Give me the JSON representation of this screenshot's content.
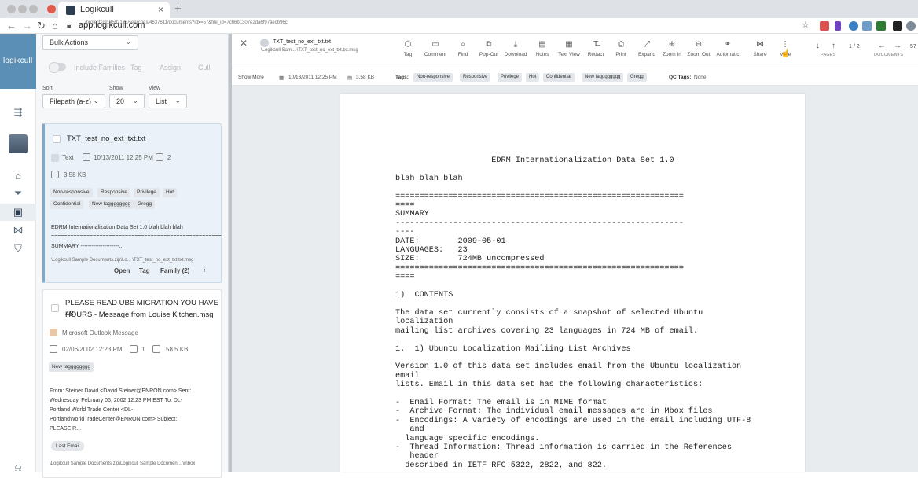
{
  "browser": {
    "tab_title": "Logikcull",
    "tab_close": "×",
    "new_tab": "+",
    "url_host": "app.logikcull.com",
    "url_path": "/projects/919592123/searches/4637611/documents?idx=57&file_id=7c66b1307e2da6f97aecb96c"
  },
  "app": {
    "logo": "logikcull"
  },
  "results": {
    "bulk_actions": "Bulk Actions",
    "include_families": "Include Families",
    "filter_tag": "Tag",
    "filter_assign": "Assign",
    "filter_cull": "Cull",
    "sort_label": "Sort",
    "sort_value": "Filepath (a-z)",
    "show_label": "Show",
    "show_value": "20",
    "view_label": "View",
    "view_value": "List",
    "cards": [
      {
        "title": "TXT_test_no_ext_txt.txt",
        "type": "Text",
        "date": "10/13/2011 12:25 PM",
        "pages": "2",
        "size": "3.58 KB",
        "tags": [
          "Non-responsive",
          "Responsive",
          "Privilege",
          "Hot",
          "Confidential",
          "New tagggggggg",
          "Gregg"
        ],
        "snippet_line1": "EDRM Internationalization Data Set 1.0 blah blah blah",
        "snippet_line2": "=====================================================",
        "snippet_line3": "SUMMARY ---------------------...",
        "path": "\\Logikcull Sample Documents.zip\\Lo...  \\TXT_test_no_ext_txt.txt.msg",
        "action_open": "Open",
        "action_tag": "Tag",
        "action_family": "Family (2)"
      },
      {
        "title_line1": "PLEASE READ UBS MIGRATION YOU HAVE 48",
        "title_line2": "HOURS - Message from Louise Kitchen.msg",
        "type": "Microsoft Outlook Message",
        "date": "02/06/2002 12:23 PM",
        "pages": "1",
        "size": "58.5 KB",
        "tags": [
          "New tagggggggg"
        ],
        "snippet_line1": "From: Steiner David <David.Steiner@ENRON.com> Sent:",
        "snippet_line2": "Wednesday, February 06, 2002 12:23 PM EST To: DL-",
        "snippet_line3": "Portland World Trade Center <DL-",
        "snippet_line4": "PortlandWorldTradeCenter@ENRON.com> Subject:",
        "snippet_line5": "PLEASE R...",
        "last_email": "Last Email",
        "path": "\\Logikcull Sample Documents.zip\\Logikcull Sample Documen...  \\inbox"
      }
    ]
  },
  "viewer": {
    "doc_name": "TXT_test_no_ext_txt.txt",
    "doc_path": "\\Logikcull Sam...  \\TXT_test_no_ext_txt.txt.msg",
    "tools": [
      {
        "label": "Tag",
        "icon": "tag-icon",
        "glyph": "⬡"
      },
      {
        "label": "Comment",
        "icon": "comment-icon",
        "glyph": "▭"
      },
      {
        "label": "Find",
        "icon": "find-icon",
        "glyph": "⌕"
      },
      {
        "label": "Pop-Out",
        "icon": "popout-icon",
        "glyph": "⧉"
      },
      {
        "label": "Download",
        "icon": "download-icon",
        "glyph": "⤓"
      },
      {
        "label": "Notes",
        "icon": "notes-icon",
        "glyph": "▤"
      },
      {
        "label": "Text View",
        "icon": "text-view-icon",
        "glyph": "▦"
      },
      {
        "label": "Redact",
        "icon": "redact-icon",
        "glyph": "T̶"
      },
      {
        "label": "Print",
        "icon": "print-icon",
        "glyph": "⎙"
      },
      {
        "label": "Expand",
        "icon": "expand-icon",
        "glyph": "⤢"
      },
      {
        "label": "Zoom In",
        "icon": "zoom-in-icon",
        "glyph": "⊕"
      },
      {
        "label": "Zoom Out",
        "icon": "zoom-out-icon",
        "glyph": "⊖"
      },
      {
        "label": "Automatic",
        "icon": "automatic-icon",
        "glyph": "⚭"
      },
      {
        "label": "Share",
        "icon": "share-icon",
        "glyph": "⋈"
      },
      {
        "label": "More",
        "icon": "more-icon",
        "glyph": "⋮"
      }
    ],
    "pages_label": "PAGES",
    "page_indicator": "1  /  2",
    "documents_label": "DOCUMENTS",
    "doc_index": "57",
    "show_more": "Show More",
    "meta_date": "10/13/2011 12:25 PM",
    "meta_size": "3.58 KB",
    "tags_label": "Tags:",
    "tags": [
      "Non-responsive",
      "Responsive",
      "Privilege",
      "Hot",
      "Confidential",
      "New tagggggggg",
      "Gregg"
    ],
    "qc_label": "QC Tags:",
    "qc_value": "None",
    "document_text": "                    EDRM Internationalization Data Set 1.0\n\nblah blah blah\n\n============================================================\n====\nSUMMARY\n------------------------------------------------------------\n----\nDATE:        2009-05-01\nLANGUAGES:   23\nSIZE:        724MB uncompressed\n============================================================\n====\n\n1)  CONTENTS\n\nThe data set currently consists of a snapshot of selected Ubuntu\nlocalization\nmailing list archives covering 23 languages in 724 MB of email.\n\n1.  1) Ubuntu Localization Mailiing List Archives\n\nVersion 1.0 of this data set includes email from the Ubuntu localization\nemail\nlists. Email in this data set has the following characteristics:\n\n-  Email Format: The email is in MIME format\n-  Archive Format: The individual email messages are in Mbox files\n-  Encodings: A variety of encodings are used in the email including UTF-8\n   and\n  language specific encodings.\n-  Thread Information: Thread information is carried in the References\n   header\n  described in IETF RFC 5322, 2822, and 822."
  },
  "colors": {
    "logo_bg": "#5b8fb6",
    "selected_card_bg": "#eaf1f8",
    "chip_bg": "#e3e7eb"
  }
}
